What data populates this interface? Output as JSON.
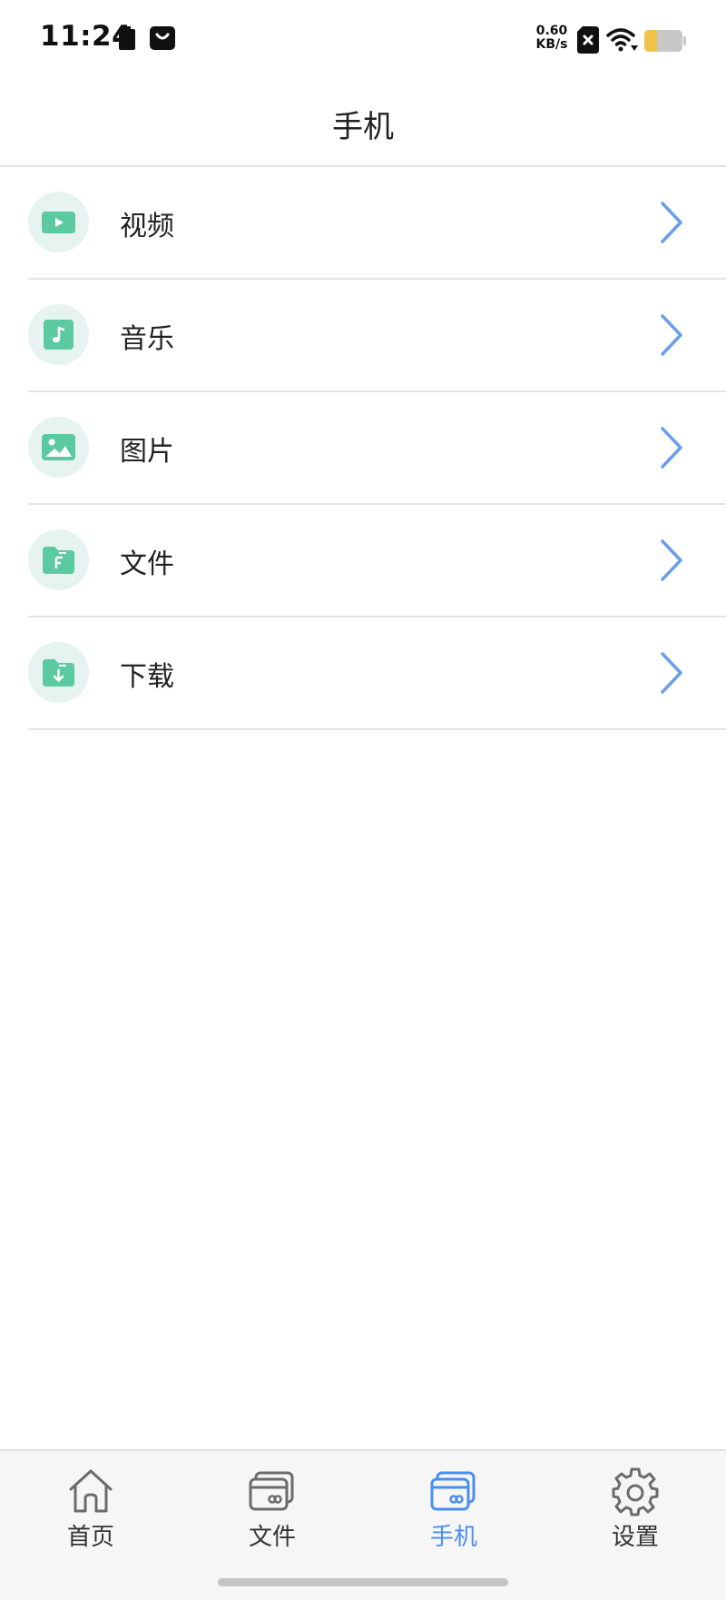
{
  "status_bar": {
    "time": "11:24",
    "net_speed_value": "0.60",
    "net_speed_unit": "KB/s",
    "icons": [
      "battery-saver-icon",
      "app-notification-icon",
      "no-sim-icon",
      "wifi-icon",
      "battery-icon"
    ]
  },
  "header": {
    "title": "手机"
  },
  "list": {
    "items": [
      {
        "label": "视频",
        "icon": "video-icon"
      },
      {
        "label": "音乐",
        "icon": "music-icon"
      },
      {
        "label": "图片",
        "icon": "image-icon"
      },
      {
        "label": "文件",
        "icon": "file-folder-icon"
      },
      {
        "label": "下载",
        "icon": "download-folder-icon"
      }
    ]
  },
  "bottom_nav": {
    "items": [
      {
        "label": "首页",
        "icon": "home-icon",
        "active": false
      },
      {
        "label": "文件",
        "icon": "cards-icon",
        "active": false
      },
      {
        "label": "手机",
        "icon": "cards-icon",
        "active": true
      },
      {
        "label": "设置",
        "icon": "gear-icon",
        "active": false
      }
    ]
  },
  "colors": {
    "accent": "#4a8ff0",
    "icon_green": "#5ccaa0",
    "icon_bg": "#e6f3f0",
    "chevron": "#6a9ee8",
    "battery_level": "#f2c14a"
  }
}
